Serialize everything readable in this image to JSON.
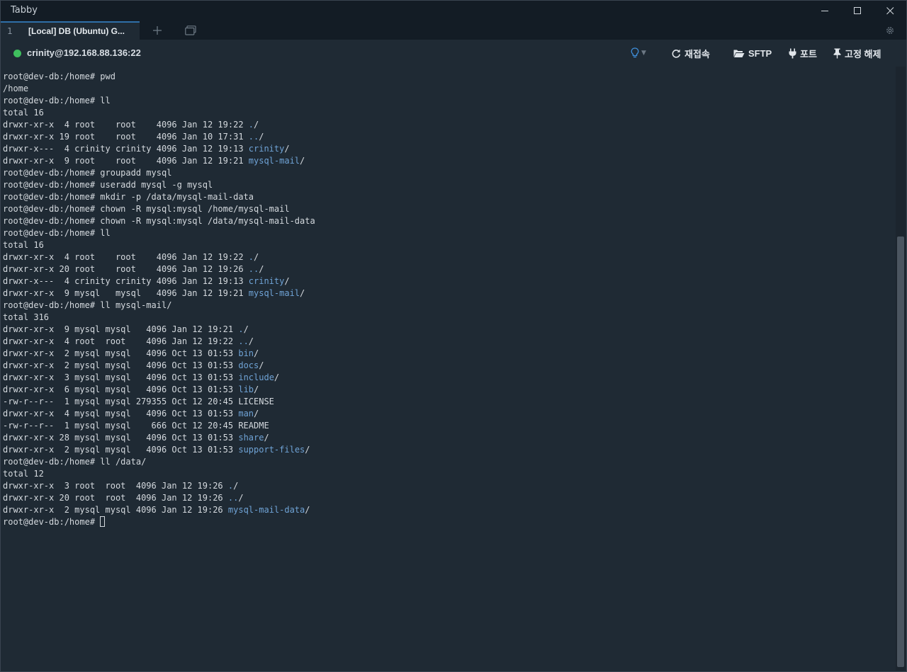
{
  "window": {
    "title": "Tabby"
  },
  "tabs": [
    {
      "index": "1",
      "label": "[Local] DB (Ubuntu) G..."
    }
  ],
  "toolbar": {
    "connection": "crinity@192.168.88.136:22",
    "reconnect_label": "재접속",
    "sftp_label": "SFTP",
    "ports_label": "포트",
    "pin_label": "고정 해제",
    "status_color": "#3fbf5e",
    "accent_color": "#3f8fdc"
  },
  "terminal": {
    "lines": [
      [
        {
          "t": "root@dev-db:/home# pwd"
        }
      ],
      [
        {
          "t": "/home"
        }
      ],
      [
        {
          "t": "root@dev-db:/home# ll"
        }
      ],
      [
        {
          "t": "total 16"
        }
      ],
      [
        {
          "t": "drwxr-xr-x  4 root    root    4096 Jan 12 19:22 "
        },
        {
          "t": ".",
          "c": "dir"
        },
        {
          "t": "/"
        }
      ],
      [
        {
          "t": "drwxr-xr-x 19 root    root    4096 Jan 10 17:31 "
        },
        {
          "t": "..",
          "c": "dir"
        },
        {
          "t": "/"
        }
      ],
      [
        {
          "t": "drwxr-x---  4 crinity crinity 4096 Jan 12 19:13 "
        },
        {
          "t": "crinity",
          "c": "dir"
        },
        {
          "t": "/"
        }
      ],
      [
        {
          "t": "drwxr-xr-x  9 root    root    4096 Jan 12 19:21 "
        },
        {
          "t": "mysql-mail",
          "c": "dir"
        },
        {
          "t": "/"
        }
      ],
      [
        {
          "t": "root@dev-db:/home# groupadd mysql"
        }
      ],
      [
        {
          "t": "root@dev-db:/home# useradd mysql -g mysql"
        }
      ],
      [
        {
          "t": "root@dev-db:/home# mkdir -p /data/mysql-mail-data"
        }
      ],
      [
        {
          "t": "root@dev-db:/home# chown -R mysql:mysql /home/mysql-mail"
        }
      ],
      [
        {
          "t": "root@dev-db:/home# chown -R mysql:mysql /data/mysql-mail-data"
        }
      ],
      [
        {
          "t": "root@dev-db:/home# ll"
        }
      ],
      [
        {
          "t": "total 16"
        }
      ],
      [
        {
          "t": "drwxr-xr-x  4 root    root    4096 Jan 12 19:22 "
        },
        {
          "t": ".",
          "c": "dir"
        },
        {
          "t": "/"
        }
      ],
      [
        {
          "t": "drwxr-xr-x 20 root    root    4096 Jan 12 19:26 "
        },
        {
          "t": "..",
          "c": "dir"
        },
        {
          "t": "/"
        }
      ],
      [
        {
          "t": "drwxr-x---  4 crinity crinity 4096 Jan 12 19:13 "
        },
        {
          "t": "crinity",
          "c": "dir"
        },
        {
          "t": "/"
        }
      ],
      [
        {
          "t": "drwxr-xr-x  9 mysql   mysql   4096 Jan 12 19:21 "
        },
        {
          "t": "mysql-mail",
          "c": "dir"
        },
        {
          "t": "/"
        }
      ],
      [
        {
          "t": "root@dev-db:/home# ll mysql-mail/"
        }
      ],
      [
        {
          "t": "total 316"
        }
      ],
      [
        {
          "t": "drwxr-xr-x  9 mysql mysql   4096 Jan 12 19:21 "
        },
        {
          "t": ".",
          "c": "dir"
        },
        {
          "t": "/"
        }
      ],
      [
        {
          "t": "drwxr-xr-x  4 root  root    4096 Jan 12 19:22 "
        },
        {
          "t": "..",
          "c": "dir"
        },
        {
          "t": "/"
        }
      ],
      [
        {
          "t": "drwxr-xr-x  2 mysql mysql   4096 Oct 13 01:53 "
        },
        {
          "t": "bin",
          "c": "dir"
        },
        {
          "t": "/"
        }
      ],
      [
        {
          "t": "drwxr-xr-x  2 mysql mysql   4096 Oct 13 01:53 "
        },
        {
          "t": "docs",
          "c": "dir"
        },
        {
          "t": "/"
        }
      ],
      [
        {
          "t": "drwxr-xr-x  3 mysql mysql   4096 Oct 13 01:53 "
        },
        {
          "t": "include",
          "c": "dir"
        },
        {
          "t": "/"
        }
      ],
      [
        {
          "t": "drwxr-xr-x  6 mysql mysql   4096 Oct 13 01:53 "
        },
        {
          "t": "lib",
          "c": "dir"
        },
        {
          "t": "/"
        }
      ],
      [
        {
          "t": "-rw-r--r--  1 mysql mysql 279355 Oct 12 20:45 LICENSE"
        }
      ],
      [
        {
          "t": "drwxr-xr-x  4 mysql mysql   4096 Oct 13 01:53 "
        },
        {
          "t": "man",
          "c": "dir"
        },
        {
          "t": "/"
        }
      ],
      [
        {
          "t": "-rw-r--r--  1 mysql mysql    666 Oct 12 20:45 README"
        }
      ],
      [
        {
          "t": "drwxr-xr-x 28 mysql mysql   4096 Oct 13 01:53 "
        },
        {
          "t": "share",
          "c": "dir"
        },
        {
          "t": "/"
        }
      ],
      [
        {
          "t": "drwxr-xr-x  2 mysql mysql   4096 Oct 13 01:53 "
        },
        {
          "t": "support-files",
          "c": "dir"
        },
        {
          "t": "/"
        }
      ],
      [
        {
          "t": "root@dev-db:/home# ll /data/"
        }
      ],
      [
        {
          "t": "total 12"
        }
      ],
      [
        {
          "t": "drwxr-xr-x  3 root  root  4096 Jan 12 19:26 "
        },
        {
          "t": ".",
          "c": "dir"
        },
        {
          "t": "/"
        }
      ],
      [
        {
          "t": "drwxr-xr-x 20 root  root  4096 Jan 12 19:26 "
        },
        {
          "t": "..",
          "c": "dir"
        },
        {
          "t": "/"
        }
      ],
      [
        {
          "t": "drwxr-xr-x  2 mysql mysql 4096 Jan 12 19:26 "
        },
        {
          "t": "mysql-mail-data",
          "c": "dir"
        },
        {
          "t": "/"
        }
      ],
      [
        {
          "t": "root@dev-db:/home# "
        },
        {
          "cursor": true
        }
      ]
    ]
  }
}
